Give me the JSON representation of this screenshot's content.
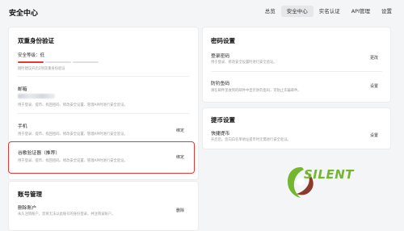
{
  "header": {
    "title": "安全中心",
    "nav": [
      "总览",
      "安全中心",
      "实名认证",
      "API管理",
      "设置"
    ],
    "active_index": 1
  },
  "two_factor": {
    "title": "双重身份验证",
    "security_level_label": "安全等级：",
    "security_level_value": "低",
    "security_level_fraction": 0.33,
    "hint": "刚时建议开启2项双重身份验证",
    "email": {
      "title": "邮箱",
      "desc": "用于登录、提币、找回密码、修改安全设置、管理API时进行安全验证。"
    },
    "phone": {
      "title": "手机",
      "desc": "用于登录、提币、找回密码、修改安全设置、管理API时进行安全验证。",
      "action": "绑定"
    },
    "google": {
      "title": "谷歌验证器（推荐）",
      "desc": "用于登录、提币、找回密码、修改安全设置、管理API时进行安全验证。",
      "action": "绑定"
    }
  },
  "account": {
    "title": "账号管理",
    "delete": {
      "title": "删除账户",
      "desc": "永久注销账户，您将无法以此账号的身份登录，并注销该账户。",
      "action": "删除"
    }
  },
  "password": {
    "title": "密码设置",
    "login": {
      "title": "登录密码",
      "desc": "用于登录、修改安全设置时进行安全验证。",
      "action": "更改"
    },
    "anti_phishing": {
      "title": "防钓鱼码",
      "desc": "请在邮件里收到的邮件中显示防钓鱼码，可防止诈骗邮件。",
      "action": "设置"
    }
  },
  "withdraw": {
    "title": "提币设置",
    "fast": {
      "title": "快捷提币",
      "desc": "开启后，您向白名单地址提币时无需进行安全验证。",
      "action": "设置"
    }
  },
  "watermark": {
    "text": "SILENT",
    "color": "#74b72e"
  },
  "colors": {
    "accent_red": "#e53935",
    "bar_active": "#e53935",
    "bar_inactive": "#e0e0e0"
  }
}
